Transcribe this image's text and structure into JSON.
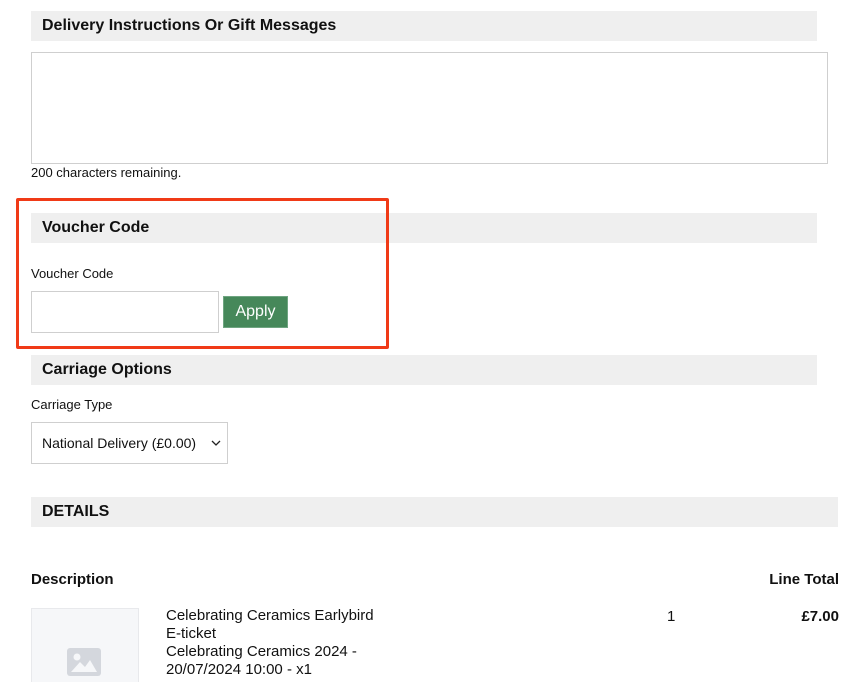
{
  "delivery": {
    "header": "Delivery Instructions Or Gift Messages",
    "message_value": "",
    "chars_remaining": "200 characters remaining."
  },
  "voucher": {
    "header": "Voucher Code",
    "field_label": "Voucher Code",
    "input_value": "",
    "apply_label": "Apply",
    "highlight_color": "#f03a17"
  },
  "carriage": {
    "header": "Carriage Options",
    "type_label": "Carriage Type",
    "selected_option": "National Delivery (£0.00)"
  },
  "details": {
    "header": "DETAILS",
    "col_description": "Description",
    "col_line_total": "Line Total",
    "items": [
      {
        "thumbnail_icon": "image-placeholder-icon",
        "description_lines": [
          "Celebrating Ceramics Earlybird",
          "E-ticket",
          "Celebrating Ceramics 2024 -",
          "20/07/2024 10:00 - x1"
        ],
        "quantity": "1",
        "line_total": "£7.00"
      }
    ]
  },
  "colors": {
    "header_bg": "#efefef",
    "apply_button_bg": "#46885a"
  }
}
